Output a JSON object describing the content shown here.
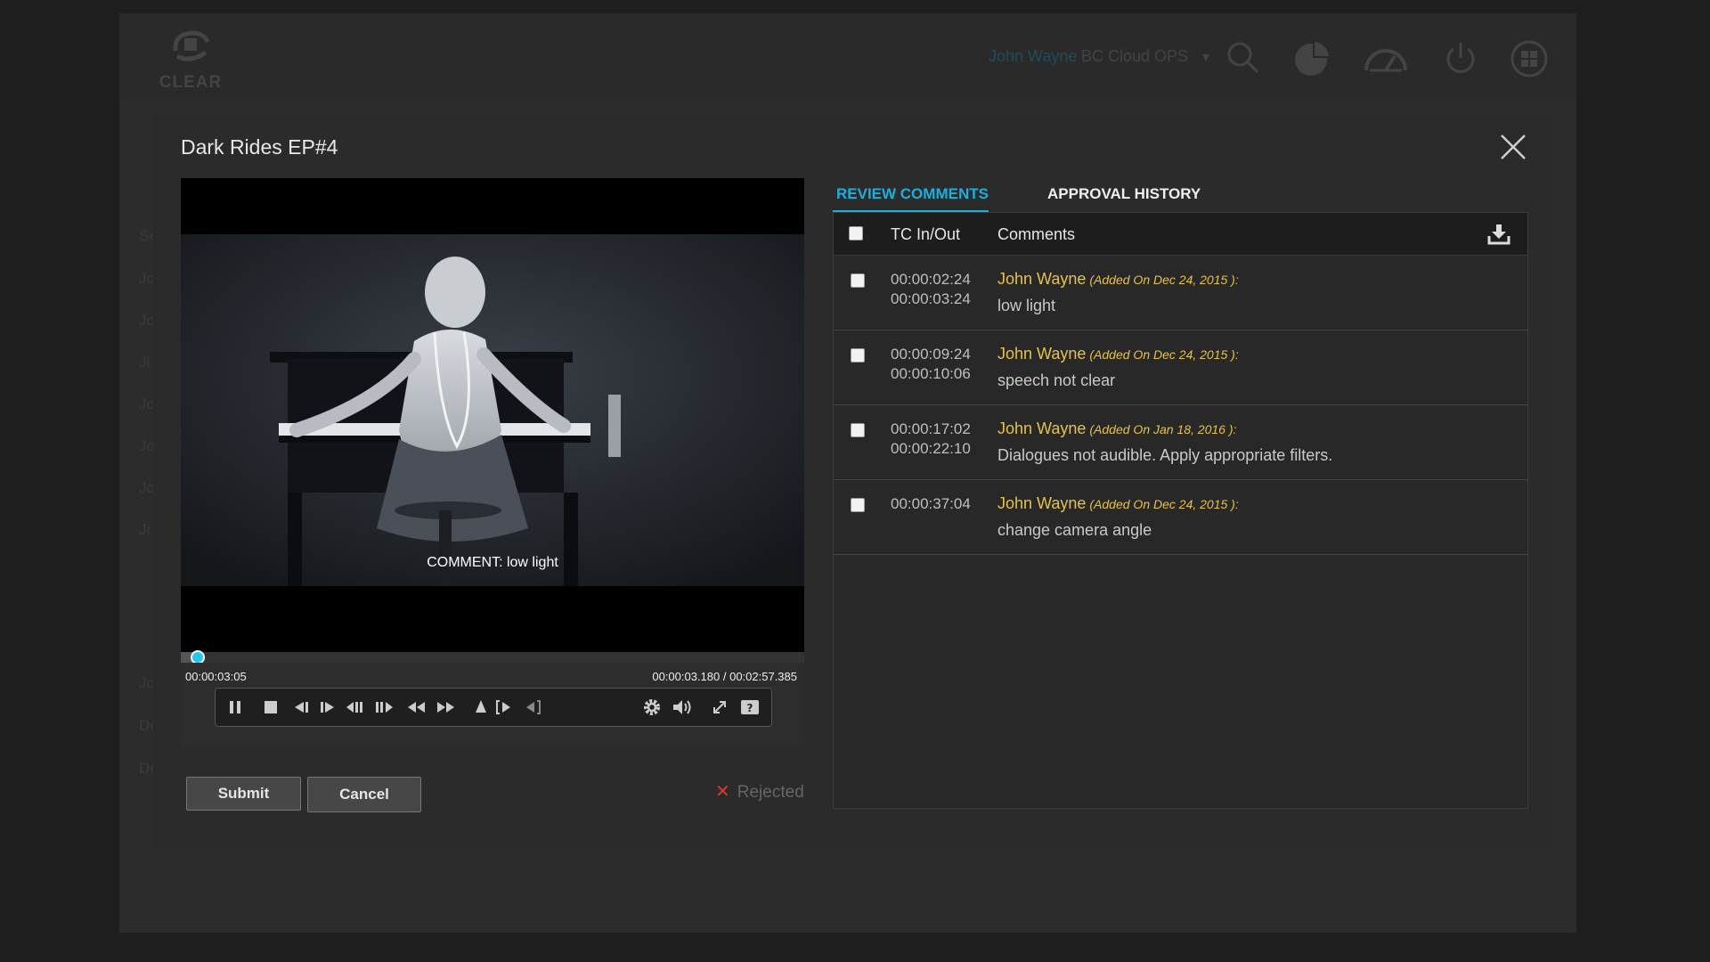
{
  "app": {
    "logo_text": "CLEAR",
    "user_name": "John Wayne",
    "org_name": "BC Cloud OPS",
    "org_caret": "▼",
    "bg_rows": [
      "Jo",
      "Jo",
      "Ji",
      "Jo",
      "Jo",
      "Jo",
      "Ji",
      "Jo",
      "De",
      "De"
    ],
    "bg_side_label": "Se"
  },
  "modal": {
    "title": "Dark Rides EP#4"
  },
  "player": {
    "subtitle": "COMMENT: low light",
    "current_time": "00:00:03:05",
    "position_total": "00:00:03.180 / 00:02:57.385",
    "progress_fraction": 0.018
  },
  "actions": {
    "submit_label": "Submit",
    "cancel_label": "Cancel",
    "status_label": "Rejected",
    "status_color": "#d63a2b"
  },
  "tabs": {
    "review_label": "REVIEW COMMENTS",
    "history_label": "APPROVAL HISTORY",
    "accent": "#1eaedb"
  },
  "table": {
    "col_tc": "TC In/Out",
    "col_comments": "Comments",
    "rows": [
      {
        "tc_in": "00:00:02:24",
        "tc_out": "00:00:03:24",
        "author": "John Wayne",
        "added": "(Added On Dec 24, 2015 ):",
        "text": "low light"
      },
      {
        "tc_in": "00:00:09:24",
        "tc_out": "00:00:10:06",
        "author": "John Wayne",
        "added": "(Added On Dec 24, 2015 ):",
        "text": "speech not clear"
      },
      {
        "tc_in": "00:00:17:02",
        "tc_out": "00:00:22:10",
        "author": "John Wayne",
        "added": "(Added On Jan 18, 2016 ):",
        "text": "Dialogues not audible. Apply appropriate filters."
      },
      {
        "tc_in": "00:00:37:04",
        "tc_out": "",
        "author": "John Wayne",
        "added": "(Added On Dec 24, 2015 ):",
        "text": "change camera angle"
      }
    ]
  }
}
